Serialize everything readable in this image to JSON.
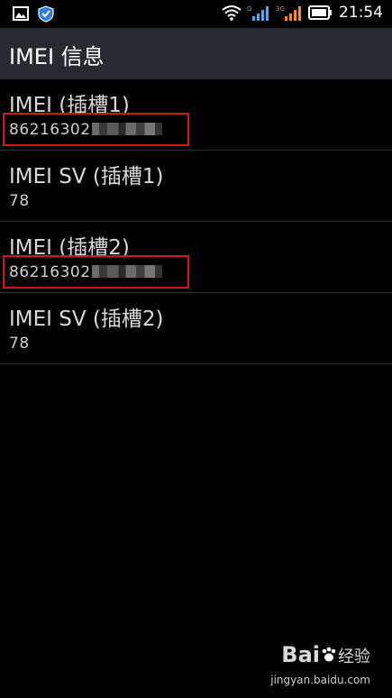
{
  "status_bar": {
    "time": "21:54",
    "icons": [
      "gallery-notification-icon",
      "shield-notification-icon",
      "wifi-icon",
      "signal-sim1-icon",
      "signal-3g-sim2-icon",
      "battery-icon"
    ]
  },
  "appbar": {
    "title": "IMEI 信息"
  },
  "items": [
    {
      "label": "IMEI (插槽1)",
      "value": "86216302",
      "redacted": true,
      "highlighted": true
    },
    {
      "label": "IMEI SV (插槽1)",
      "value": "78",
      "redacted": false,
      "highlighted": false
    },
    {
      "label": "IMEI (插槽2)",
      "value": "86216302",
      "redacted": true,
      "highlighted": true
    },
    {
      "label": "IMEI SV (插槽2)",
      "value": "78",
      "redacted": false,
      "highlighted": false
    }
  ],
  "colors": {
    "appbar": "#262b32",
    "highlight": "#d11818",
    "background": "#000000"
  },
  "watermark": {
    "brand": "Bai",
    "brand2": "经验",
    "url": "jingyan.baidu.com"
  }
}
